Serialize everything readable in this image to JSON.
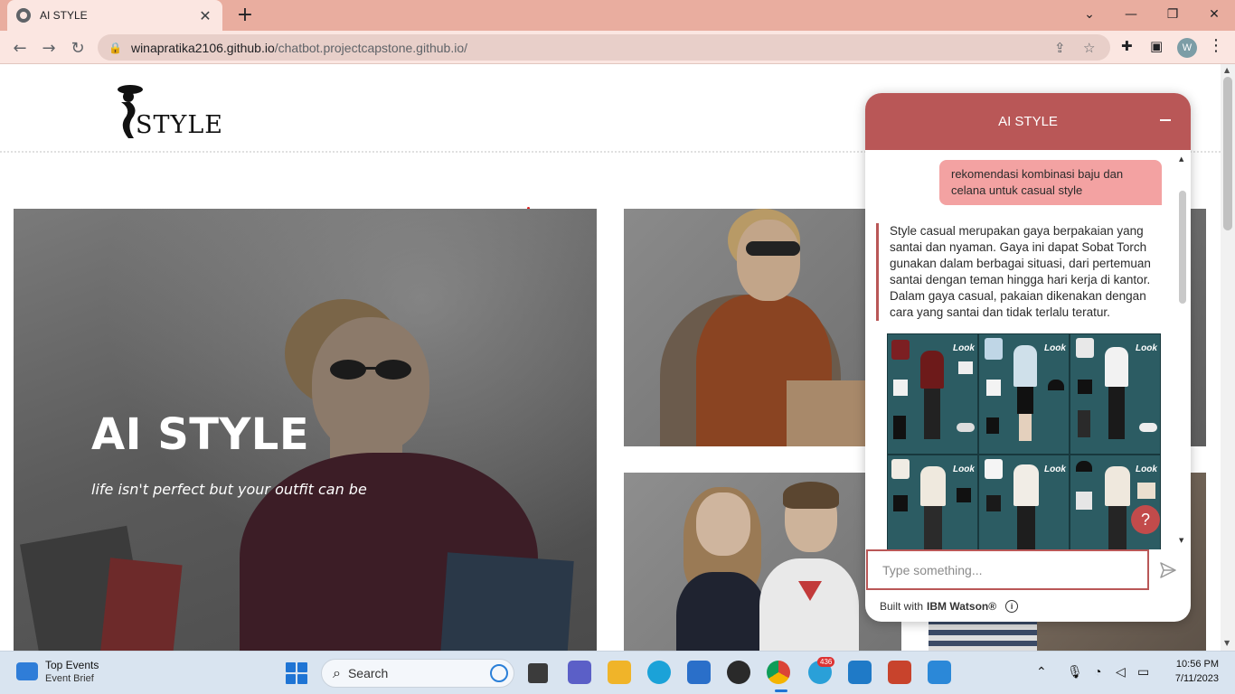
{
  "browser": {
    "tab_title": "AI STYLE",
    "url_host": "winapratika2106.github.io",
    "url_path": "/chatbot.projectcapstone.github.io/",
    "profile_initial": "W"
  },
  "site": {
    "logo_text": "STYLE",
    "hero_title": "AI STYLE",
    "hero_subtitle": "life isn't perfect but your outfit can be"
  },
  "chat": {
    "title": "AI STYLE",
    "user_message": "rekomendasi kombinasi baju dan celana untuk casual style",
    "bot_message": "Style casual merupakan gaya berpakaian yang santai dan nyaman. Gaya ini dapat Sobat Torch gunakan dalam berbagai situasi, dari pertemuan santai dengan teman hingga hari kerja di kantor. Dalam gaya casual, pakaian dikenakan dengan cara yang santai dan tidak terlalu teratur.",
    "image_label": "Look",
    "help_label": "?",
    "input_placeholder": "Type something...",
    "footer_prefix": "Built with",
    "footer_brand": "IBM Watson®",
    "info_label": "i",
    "colors": {
      "header": "#b95757",
      "user_bubble": "#f3a2a2"
    }
  },
  "taskbar": {
    "widget_title": "Top Events",
    "widget_subtitle": "Event Brief",
    "search_label": "Search",
    "telegram_badge": "436",
    "time": "10:56 PM",
    "date": "7/11/2023"
  }
}
